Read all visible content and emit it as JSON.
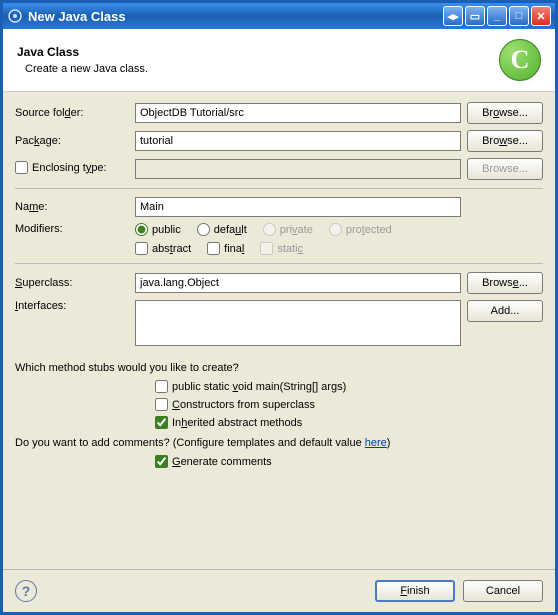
{
  "window": {
    "title": "New Java Class"
  },
  "header": {
    "title": "Java Class",
    "subtitle": "Create a new Java class.",
    "icon_letter": "C"
  },
  "labels": {
    "source_folder": "Source folder:",
    "package": "Package:",
    "enclosing_type": "Enclosing type:",
    "name": "Name:",
    "modifiers": "Modifiers:",
    "superclass": "Superclass:",
    "interfaces": "Interfaces:"
  },
  "values": {
    "source_folder": "ObjectDB Tutorial/src",
    "package": "tutorial",
    "enclosing_type": "",
    "name": "Main",
    "superclass": "java.lang.Object"
  },
  "buttons": {
    "browse": "Browse...",
    "add": "Add...",
    "finish": "Finish",
    "cancel": "Cancel"
  },
  "modifiers": {
    "public": "public",
    "default": "default",
    "private": "private",
    "protected": "protected",
    "abstract": "abstract",
    "final": "final",
    "static": "static"
  },
  "stubs": {
    "question": "Which method stubs would you like to create?",
    "main": "public static void main(String[] args)",
    "constructors": "Constructors from superclass",
    "inherited": "Inherited abstract methods"
  },
  "comments": {
    "question_prefix": "Do you want to add comments? (Configure templates and default value ",
    "here": "here",
    "question_suffix": ")",
    "generate": "Generate comments"
  }
}
